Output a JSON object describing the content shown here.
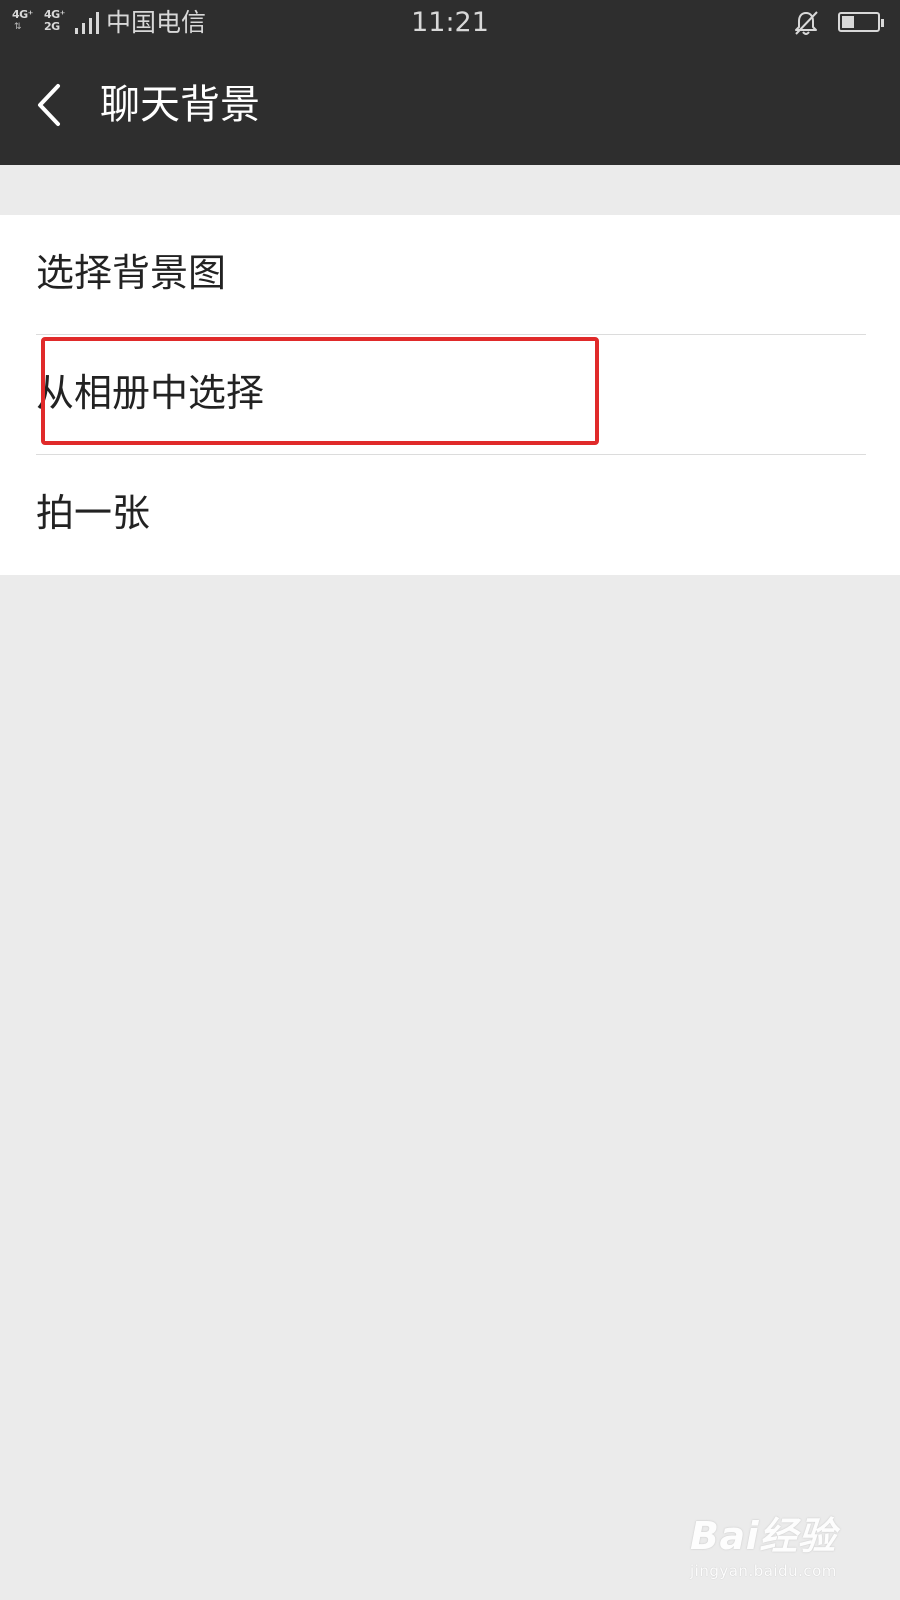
{
  "status_bar": {
    "network_1": "4G⁺",
    "network_2": "4G⁺",
    "network_3": "2G",
    "carrier": "中国电信",
    "time": "11:21",
    "battery_level": 0.35
  },
  "app_bar": {
    "title": "聊天背景"
  },
  "menu": {
    "items": [
      {
        "label": "选择背景图"
      },
      {
        "label": "从相册中选择"
      },
      {
        "label": "拍一张"
      }
    ]
  },
  "watermark": {
    "main": "Bai经验",
    "sub": "jingyan.baidu.com"
  },
  "colors": {
    "bar_background": "#2e2e2e",
    "page_background": "#ebebeb",
    "highlight": "#e02a2a"
  }
}
